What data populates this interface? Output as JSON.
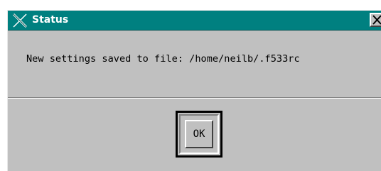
{
  "window": {
    "title": "Status",
    "title_icon": "x-logo-icon",
    "close_icon": "close-icon"
  },
  "message": {
    "text": "New settings saved to file: /home/neilb/.f533rc"
  },
  "buttons": {
    "ok_label": "OK"
  },
  "colors": {
    "titlebar": "#008080",
    "body": "#c0c0c0",
    "title_text": "#ffffff"
  }
}
